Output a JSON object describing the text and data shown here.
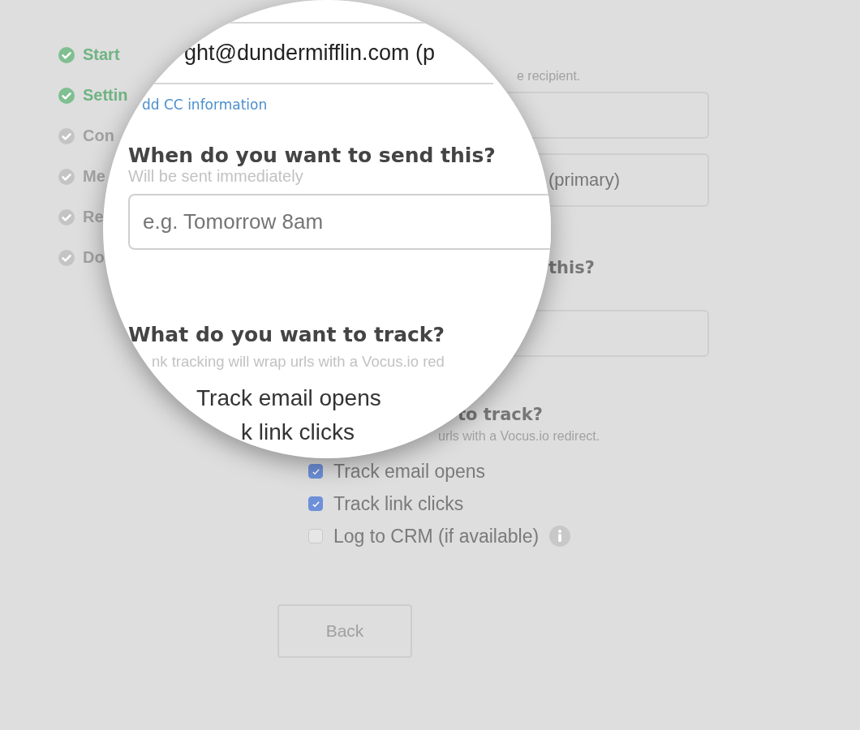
{
  "steps": [
    {
      "label": "Start",
      "done": true
    },
    {
      "label": "Settin",
      "done": true
    },
    {
      "label": "Con",
      "done": false
    },
    {
      "label": "Me",
      "done": false
    },
    {
      "label": "Re",
      "done": false
    },
    {
      "label": "Do",
      "done": false
    }
  ],
  "form": {
    "hint": "e recipient.",
    "from_value": "(primary)",
    "heading": "this?",
    "tracking_heading": "to track?",
    "tracking_hint": "urls with a Vocus.io redirect.",
    "options": [
      {
        "label": "Track email opens",
        "checked": true,
        "info": false
      },
      {
        "label": "Track link clicks",
        "checked": true,
        "info": false
      },
      {
        "label": "Log to CRM (if available)",
        "checked": false,
        "info": true
      }
    ],
    "back_button": "Back"
  },
  "magnifier": {
    "email": "ght@dundermifflin.com (p",
    "cc_link": "dd CC information",
    "send_heading": "When do you want to send this?",
    "send_hint": "Will be sent immediately",
    "send_placeholder": "e.g. Tomorrow 8am",
    "track_heading": "What do you want to track?",
    "track_hint": "nk tracking will wrap urls with a Vocus.io red",
    "options": [
      "Track email opens",
      "k link clicks"
    ]
  }
}
